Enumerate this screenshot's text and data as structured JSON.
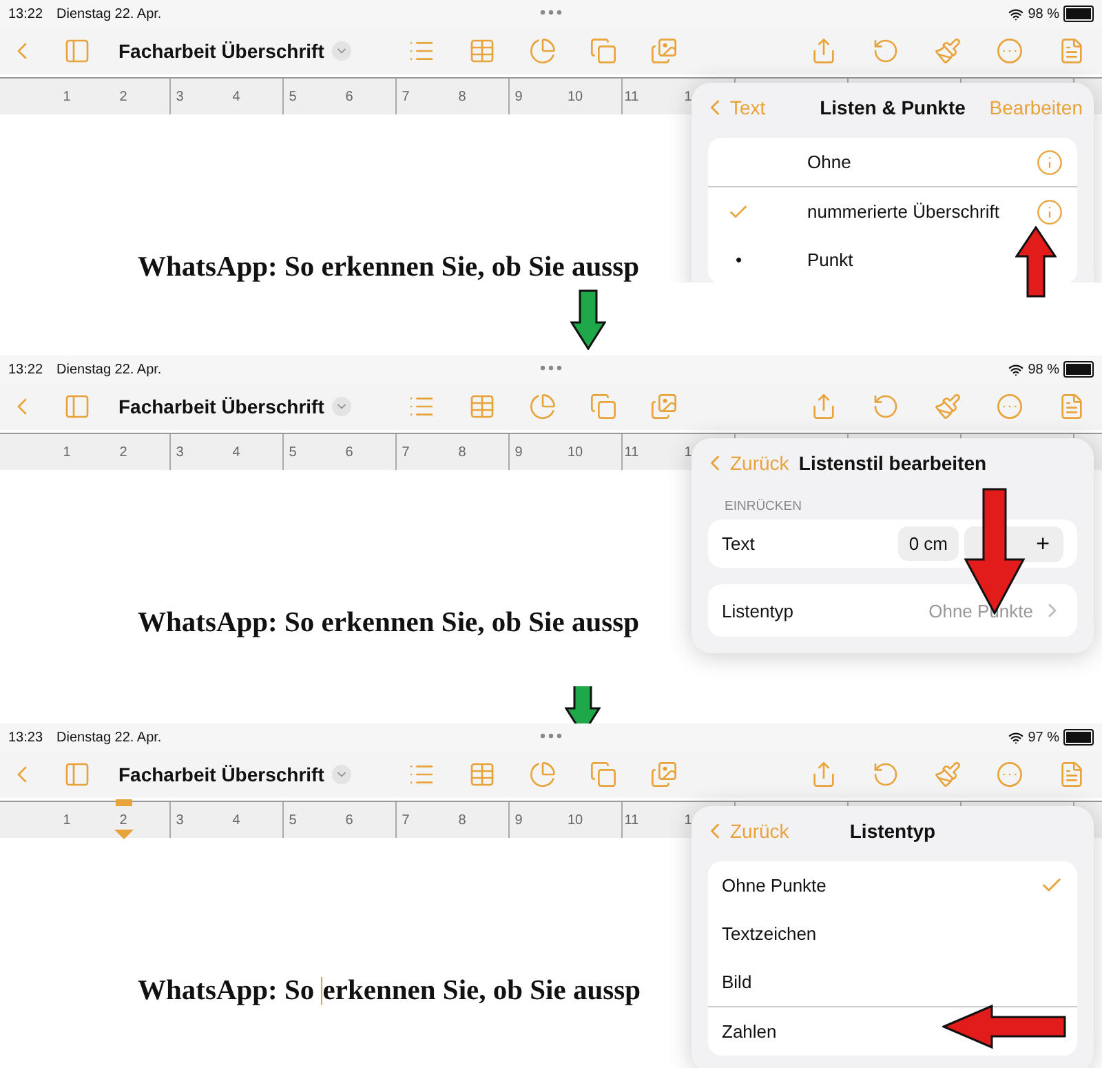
{
  "screens": [
    {
      "status": {
        "time": "13:22",
        "date": "Dienstag 22. Apr.",
        "battery": "98 %"
      },
      "toolbar": {
        "title": "Facharbeit Überschrift"
      },
      "ruler": [
        "1",
        "2",
        "3",
        "4",
        "5",
        "6",
        "7",
        "8",
        "9",
        "10",
        "11",
        "1"
      ],
      "indent_marker": false,
      "heading": [
        "WhatsApp: So erkennen Sie, ob Sie aussp"
      ],
      "popover": {
        "kind": "list",
        "back": "Text",
        "title": "Listen & Punkte",
        "action": "Bearbeiten",
        "rows": [
          {
            "label": "Ohne",
            "selected": false,
            "info": true,
            "separated": false
          },
          {
            "label": "nummerierte Überschrift",
            "selected": true,
            "info": true,
            "separated": true
          },
          {
            "label": "Punkt",
            "marker": "•",
            "selected": false,
            "info": false,
            "separated": false
          }
        ]
      }
    },
    {
      "status": {
        "time": "13:22",
        "date": "Dienstag 22. Apr.",
        "battery": "98 %"
      },
      "toolbar": {
        "title": "Facharbeit Überschrift"
      },
      "ruler": [
        "1",
        "2",
        "3",
        "4",
        "5",
        "6",
        "7",
        "8",
        "9",
        "10",
        "11",
        "1"
      ],
      "indent_marker": false,
      "heading": [
        "WhatsApp: So erkennen Sie, ob Sie aussp"
      ],
      "popover": {
        "kind": "edit",
        "back": "Zurück",
        "title": "Listenstil bearbeiten",
        "section": "EINRÜCKEN",
        "stepper": {
          "label": "Text",
          "value": "0 cm",
          "plus": "+"
        },
        "nav": {
          "label": "Listentyp",
          "value": "Ohne Punkte"
        }
      }
    },
    {
      "status": {
        "time": "13:23",
        "date": "Dienstag 22. Apr.",
        "battery": "97 %"
      },
      "toolbar": {
        "title": "Facharbeit Überschrift"
      },
      "ruler": [
        "1",
        "2",
        "3",
        "4",
        "5",
        "6",
        "7",
        "8",
        "9",
        "10",
        "11",
        "1"
      ],
      "indent_marker": true,
      "heading": [
        "WhatsApp: So ",
        "erkennen Sie, ob Sie aussp"
      ],
      "popover": {
        "kind": "select",
        "back": "Zurück",
        "title": "Listentyp",
        "rows": [
          {
            "label": "Ohne Punkte",
            "selected": true,
            "separated": false
          },
          {
            "label": "Textzeichen",
            "selected": false,
            "separated": false
          },
          {
            "label": "Bild",
            "selected": false,
            "separated": false
          },
          {
            "label": "Zahlen",
            "selected": false,
            "separated": true
          }
        ]
      }
    }
  ]
}
